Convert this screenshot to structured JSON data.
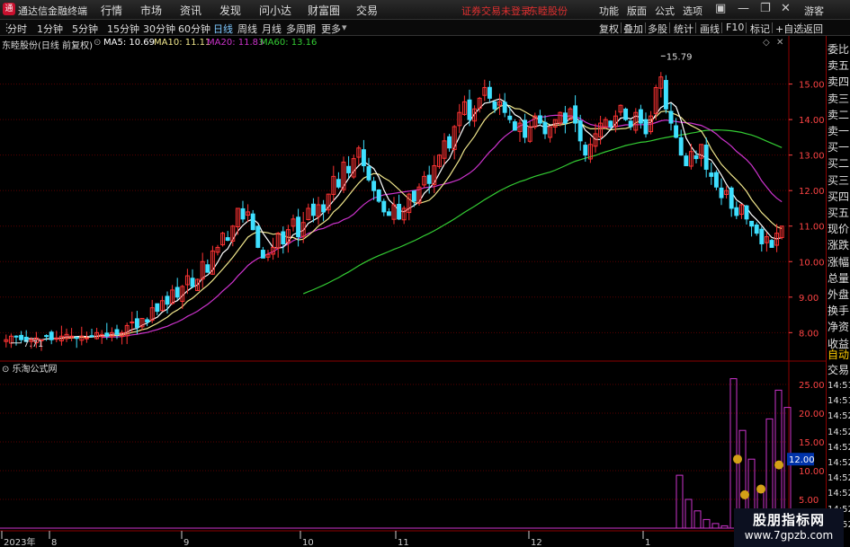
{
  "app": {
    "name": "通达信金融终端",
    "menus": [
      "行情",
      "市场",
      "资讯",
      "发现",
      "问小达",
      "财富圈",
      "交易"
    ],
    "status": "证券交易未登录",
    "stock": "东睦股份",
    "right_menus": [
      "功能",
      "版面",
      "公式",
      "选项"
    ],
    "user": "游客"
  },
  "toolbar": {
    "timeframes": [
      "分时",
      "1分钟",
      "5分钟",
      "15分钟",
      "30分钟",
      "60分钟",
      "日线",
      "周线",
      "月线",
      "多周期",
      "更多"
    ],
    "active": "日线",
    "right": [
      "复权",
      "叠加",
      "多股",
      "统计",
      "画线",
      "F10",
      "标记",
      "+自选",
      "返回"
    ]
  },
  "legend": {
    "title": "东睦股份(日线 前复权)",
    "ma5": "MA5: 10.69",
    "ma10": "MA10: 11.11",
    "ma20": "MA20: 11.83",
    "ma60": "MA60: 13.16",
    "c_ma5": "#ffffff",
    "c_ma10": "#f0e68c",
    "c_ma20": "#cc33cc",
    "c_ma60": "#33cc33"
  },
  "annotations": {
    "high": "15.79",
    "low": "7.71"
  },
  "lower": {
    "title": "乐淘公式网",
    "badge": "12.00"
  },
  "colors": {
    "up": "#ff3333",
    "down": "#3fe0ff",
    "grid": "#5a0000"
  },
  "side": {
    "items": [
      "委比",
      "卖五",
      "卖四",
      "卖三",
      "卖二",
      "卖一",
      "买一",
      "买二",
      "买三",
      "买四",
      "买五",
      "现价",
      "涨跌",
      "涨幅",
      "总量",
      "外盘",
      "换手",
      "净资",
      "收益"
    ],
    "auto": "自动",
    "trade": "交易",
    "times": [
      "14:51",
      "14:51",
      "14:52",
      "14:52",
      "14:52",
      "14:52",
      "14:52",
      "14:52",
      "14:52",
      "14:52"
    ]
  },
  "watermark": {
    "line1": "股朋指标网",
    "line2": "www.7gpzb.com"
  },
  "chart_data": {
    "type": "candlestick",
    "price_axis": {
      "ticks": [
        8.0,
        9.0,
        10.0,
        11.0,
        12.0,
        13.0,
        14.0,
        15.0
      ],
      "range": [
        7.3,
        15.9
      ]
    },
    "indicator_axis": {
      "ticks": [
        5.0,
        10.0,
        15.0,
        20.0,
        25.0
      ],
      "range": [
        0,
        27.5
      ]
    },
    "x_labels": [
      "2023年",
      "8",
      "9",
      "10",
      "11",
      "12",
      "1"
    ],
    "series_close": [
      7.8,
      7.9,
      7.9,
      7.8,
      7.75,
      7.8,
      7.85,
      7.8,
      7.9,
      7.8,
      7.85,
      7.9,
      7.95,
      7.9,
      7.85,
      7.9,
      7.85,
      7.9,
      8.0,
      7.95,
      7.9,
      8.0,
      7.95,
      8.0,
      8.2,
      8.3,
      8.15,
      8.4,
      8.3,
      8.7,
      8.6,
      8.9,
      8.8,
      9.2,
      9.0,
      9.3,
      9.6,
      9.3,
      9.5,
      10.0,
      9.7,
      10.3,
      10.4,
      10.8,
      10.6,
      11.0,
      11.5,
      11.2,
      11.4,
      10.9,
      10.4,
      10.1,
      10.2,
      10.4,
      10.8,
      10.5,
      10.9,
      11.2,
      10.7,
      11.1,
      11.5,
      11.3,
      11.6,
      11.4,
      11.9,
      12.4,
      12.1,
      12.8,
      12.5,
      12.9,
      13.2,
      12.7,
      12.3,
      12.0,
      11.7,
      11.4,
      11.3,
      11.6,
      11.2,
      11.5,
      11.9,
      11.7,
      12.1,
      12.4,
      12.2,
      12.7,
      13.0,
      13.4,
      13.2,
      13.8,
      14.2,
      14.5,
      14.0,
      14.3,
      14.6,
      14.9,
      14.6,
      14.3,
      14.5,
      14.2,
      14.0,
      13.7,
      13.9,
      13.5,
      13.8,
      14.1,
      13.9,
      13.6,
      13.8,
      14.0,
      14.2,
      13.9,
      14.3,
      13.9,
      13.4,
      13.0,
      13.3,
      13.6,
      13.9,
      14.0,
      13.8,
      14.1,
      14.4,
      14.0,
      13.8,
      14.2,
      13.9,
      13.6,
      14.1,
      14.9,
      15.2,
      14.3,
      13.9,
      13.5,
      13.0,
      12.7,
      13.1,
      12.9,
      13.3,
      12.6,
      12.4,
      12.1,
      11.8,
      12.0,
      11.5,
      11.3,
      11.6,
      11.2,
      11.0,
      10.8,
      10.5,
      10.7,
      10.4,
      10.8,
      11.0
    ],
    "ma_values": {
      "MA5": 10.69,
      "MA10": 11.11,
      "MA20": 11.83,
      "MA60": 13.16
    },
    "price_high": 15.79,
    "price_low": 7.71,
    "indicator_bars": [
      {
        "x": 0,
        "h": 9.2
      },
      {
        "x": 1,
        "h": 5.0
      },
      {
        "x": 2,
        "h": 3.0
      },
      {
        "x": 3,
        "h": 1.5
      },
      {
        "x": 4,
        "h": 0.8
      },
      {
        "x": 5,
        "h": 0.4
      },
      {
        "x": 6,
        "h": 26.0
      },
      {
        "x": 7,
        "h": 17.0
      },
      {
        "x": 8,
        "h": 12.0
      },
      {
        "x": 9,
        "h": 7.0
      },
      {
        "x": 10,
        "h": 19.0
      },
      {
        "x": 11,
        "h": 24.0
      },
      {
        "x": 12,
        "h": 21.0
      }
    ],
    "markers": [
      12.0,
      5.8,
      6.8,
      11.0
    ]
  }
}
